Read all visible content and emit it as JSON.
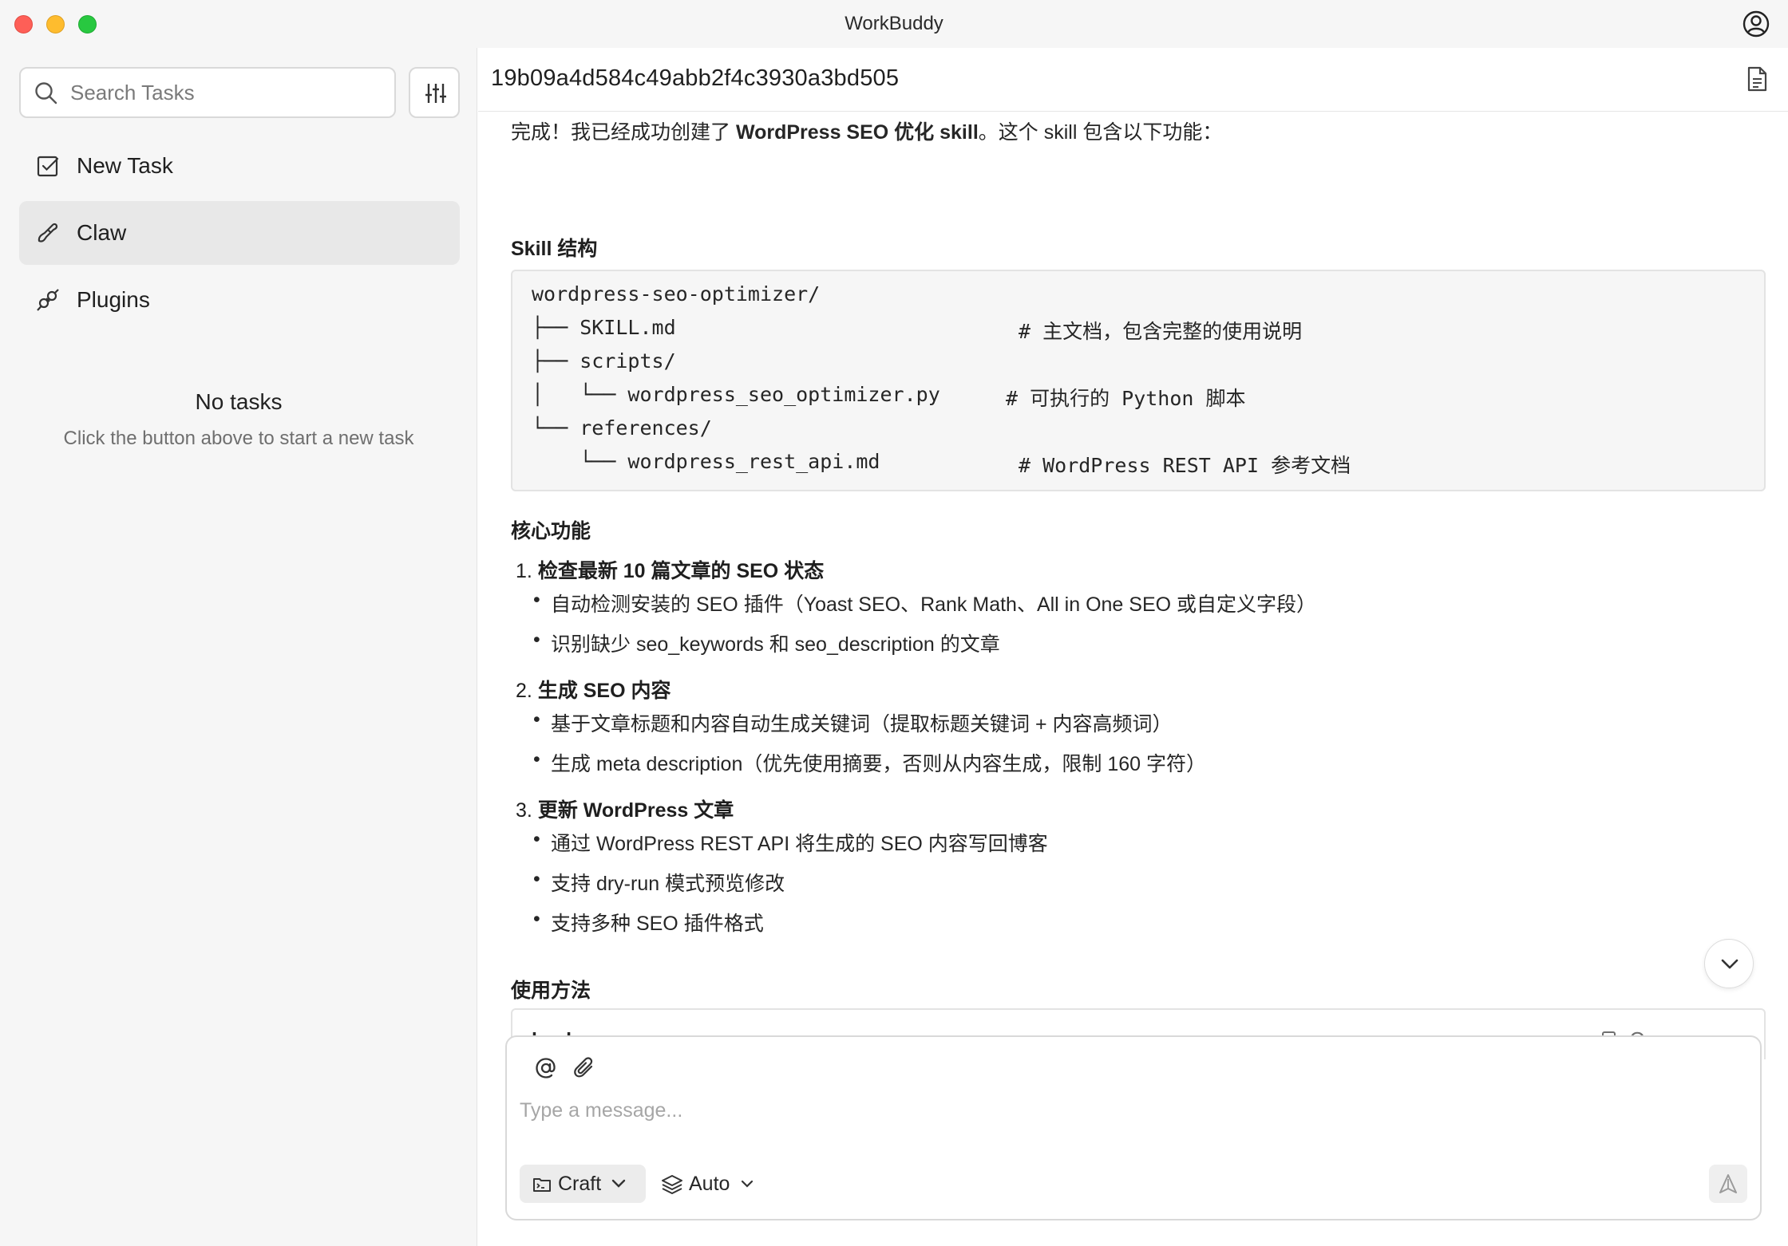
{
  "window": {
    "title": "WorkBuddy"
  },
  "sidebar": {
    "search_placeholder": "Search Tasks",
    "items": [
      {
        "label": "New Task",
        "icon": "new-task-icon"
      },
      {
        "label": "Claw",
        "icon": "claw-icon",
        "active": true
      },
      {
        "label": "Plugins",
        "icon": "plugin-icon"
      }
    ],
    "empty": {
      "title": "No tasks",
      "subtitle": "Click the button above to start a new task"
    }
  },
  "main": {
    "task_id": "19b09a4d584c49abb2f4c3930a3bd505",
    "intro": {
      "prefix": "完成！我已经成功创建了 ",
      "bold": "WordPress SEO 优化 skill",
      "suffix": "。这个 skill 包含以下功能："
    },
    "structure_heading": "Skill 结构",
    "tree": [
      {
        "path": "wordpress-seo-optimizer/",
        "comment": ""
      },
      {
        "path": "├── SKILL.md",
        "comment": "# 主文档，包含完整的使用说明"
      },
      {
        "path": "├── scripts/",
        "comment": ""
      },
      {
        "path": "│   └── wordpress_seo_optimizer.py",
        "comment": "# 可执行的 Python 脚本"
      },
      {
        "path": "└── references/",
        "comment": ""
      },
      {
        "path": "    └── wordpress_rest_api.md",
        "comment": "# WordPress REST API 参考文档"
      }
    ],
    "features_heading": "核心功能",
    "features": [
      {
        "num": "1.",
        "title": "检查最新 10 篇文章的 SEO 状态",
        "bullets": [
          "自动检测安装的 SEO 插件（Yoast SEO、Rank Math、All in One SEO 或自定义字段）",
          "识别缺少 seo_keywords 和 seo_description 的文章"
        ]
      },
      {
        "num": "2.",
        "title": "生成 SEO 内容",
        "bullets": [
          "基于文章标题和内容自动生成关键词（提取标题关键词 + 内容高频词）",
          "生成 meta description（优先使用摘要，否则从内容生成，限制 160 字符）"
        ]
      },
      {
        "num": "3.",
        "title": "更新 WordPress 文章",
        "bullets": [
          "通过 WordPress REST API 将生成的 SEO 内容写回博客",
          "支持 dry-run 模式预览修改",
          "支持多种 SEO 插件格式"
        ]
      }
    ],
    "usage_heading": "使用方法",
    "code_block": {
      "lang": "bash",
      "copy_label": "Copy"
    }
  },
  "composer": {
    "placeholder": "Type a message...",
    "mode_label": "Craft",
    "model_label": "Auto"
  }
}
